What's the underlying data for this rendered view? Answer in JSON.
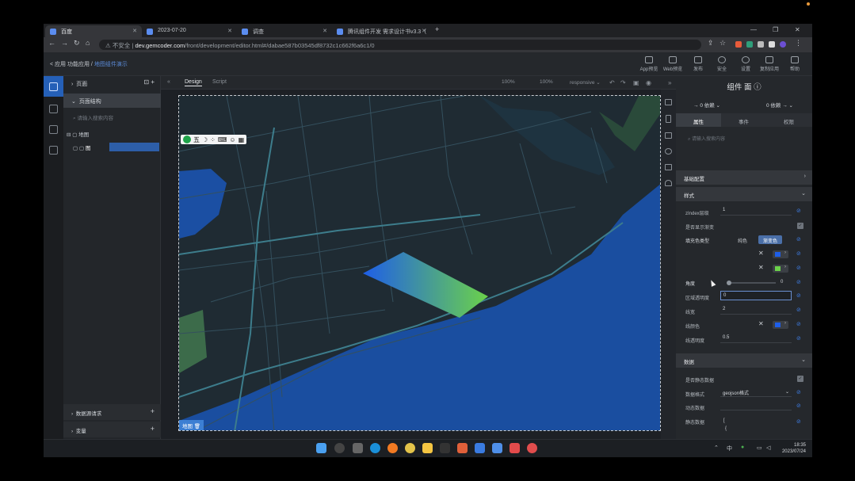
{
  "browser": {
    "tabs": [
      {
        "label": "百度"
      },
      {
        "label": "2023-07-20"
      },
      {
        "label": "调查"
      },
      {
        "label": "腾讯组件开发 需求设计书v3.3（"
      }
    ],
    "security_label": "不安全",
    "url_host": "dev.gemcoder.com",
    "url_path": "/front/development/editor.html#/dabae587b03545df8732c1c662f6a6c1/0"
  },
  "app": {
    "back_label": "< 应用 功能应用",
    "breadcrumb_current": "地图组件演示",
    "toolbar": [
      {
        "label": "App预览",
        "icon": "phone-icon"
      },
      {
        "label": "Web预览",
        "icon": "monitor-icon"
      },
      {
        "label": "发布",
        "icon": "send-icon"
      },
      {
        "label": "安全",
        "icon": "shield-icon"
      },
      {
        "label": "设置",
        "icon": "gear-icon"
      },
      {
        "label": "复制应用",
        "icon": "copy-icon"
      },
      {
        "label": "帮助",
        "icon": "help-icon"
      }
    ]
  },
  "left": {
    "pages_label": "页面",
    "structure_label": "页面结构",
    "search_placeholder": "请输入搜索内容",
    "tree_root": "地图",
    "tree_child": "图",
    "datasource_label": "数据源请求",
    "var_label": "变量"
  },
  "canvas": {
    "tab_design": "Design",
    "tab_script": "Script",
    "zoom_a": "100%",
    "zoom_b": "100%",
    "device": "responsive",
    "map_toolbar_text": "五",
    "map_label": "地图"
  },
  "right": {
    "title": "组件 面",
    "dep_left": "0 依赖",
    "dep_right": "0 依赖",
    "tabs": [
      "属性",
      "事件",
      "权限"
    ],
    "search_placeholder": "请输入搜索内容",
    "section_basic": "基础配置",
    "section_style": "样式",
    "zindex_label": "zIndex层级",
    "zindex_value": "1",
    "gradient_label": "是否显示渐变",
    "fill_type_label": "填充色类型",
    "fill_opt1": "纯色",
    "fill_opt2": "渐变色",
    "angle_label": "角度",
    "angle_value": "0",
    "opacity_label": "区域透明度",
    "opacity_value": "0",
    "linewidth_label": "线宽",
    "linewidth_value": "2",
    "linecolor_label": "线颜色",
    "lineopacity_label": "线透明度",
    "lineopacity_value": "0.5",
    "section_data": "数据",
    "static_label": "是否静态数据",
    "format_label": "数据格式",
    "format_value": "geojson格式",
    "dynamic_label": "动态数据",
    "static_data_label": "静态数据",
    "static_data_line1": "[",
    "static_data_line2": "{"
  },
  "colors": {
    "swatch_blue": "#1e5ee8",
    "swatch_green": "#6bd24a",
    "accent": "#2b6bd0"
  },
  "taskbar": {
    "time": "18:35",
    "date": "2023/07/24",
    "ime": "中"
  }
}
